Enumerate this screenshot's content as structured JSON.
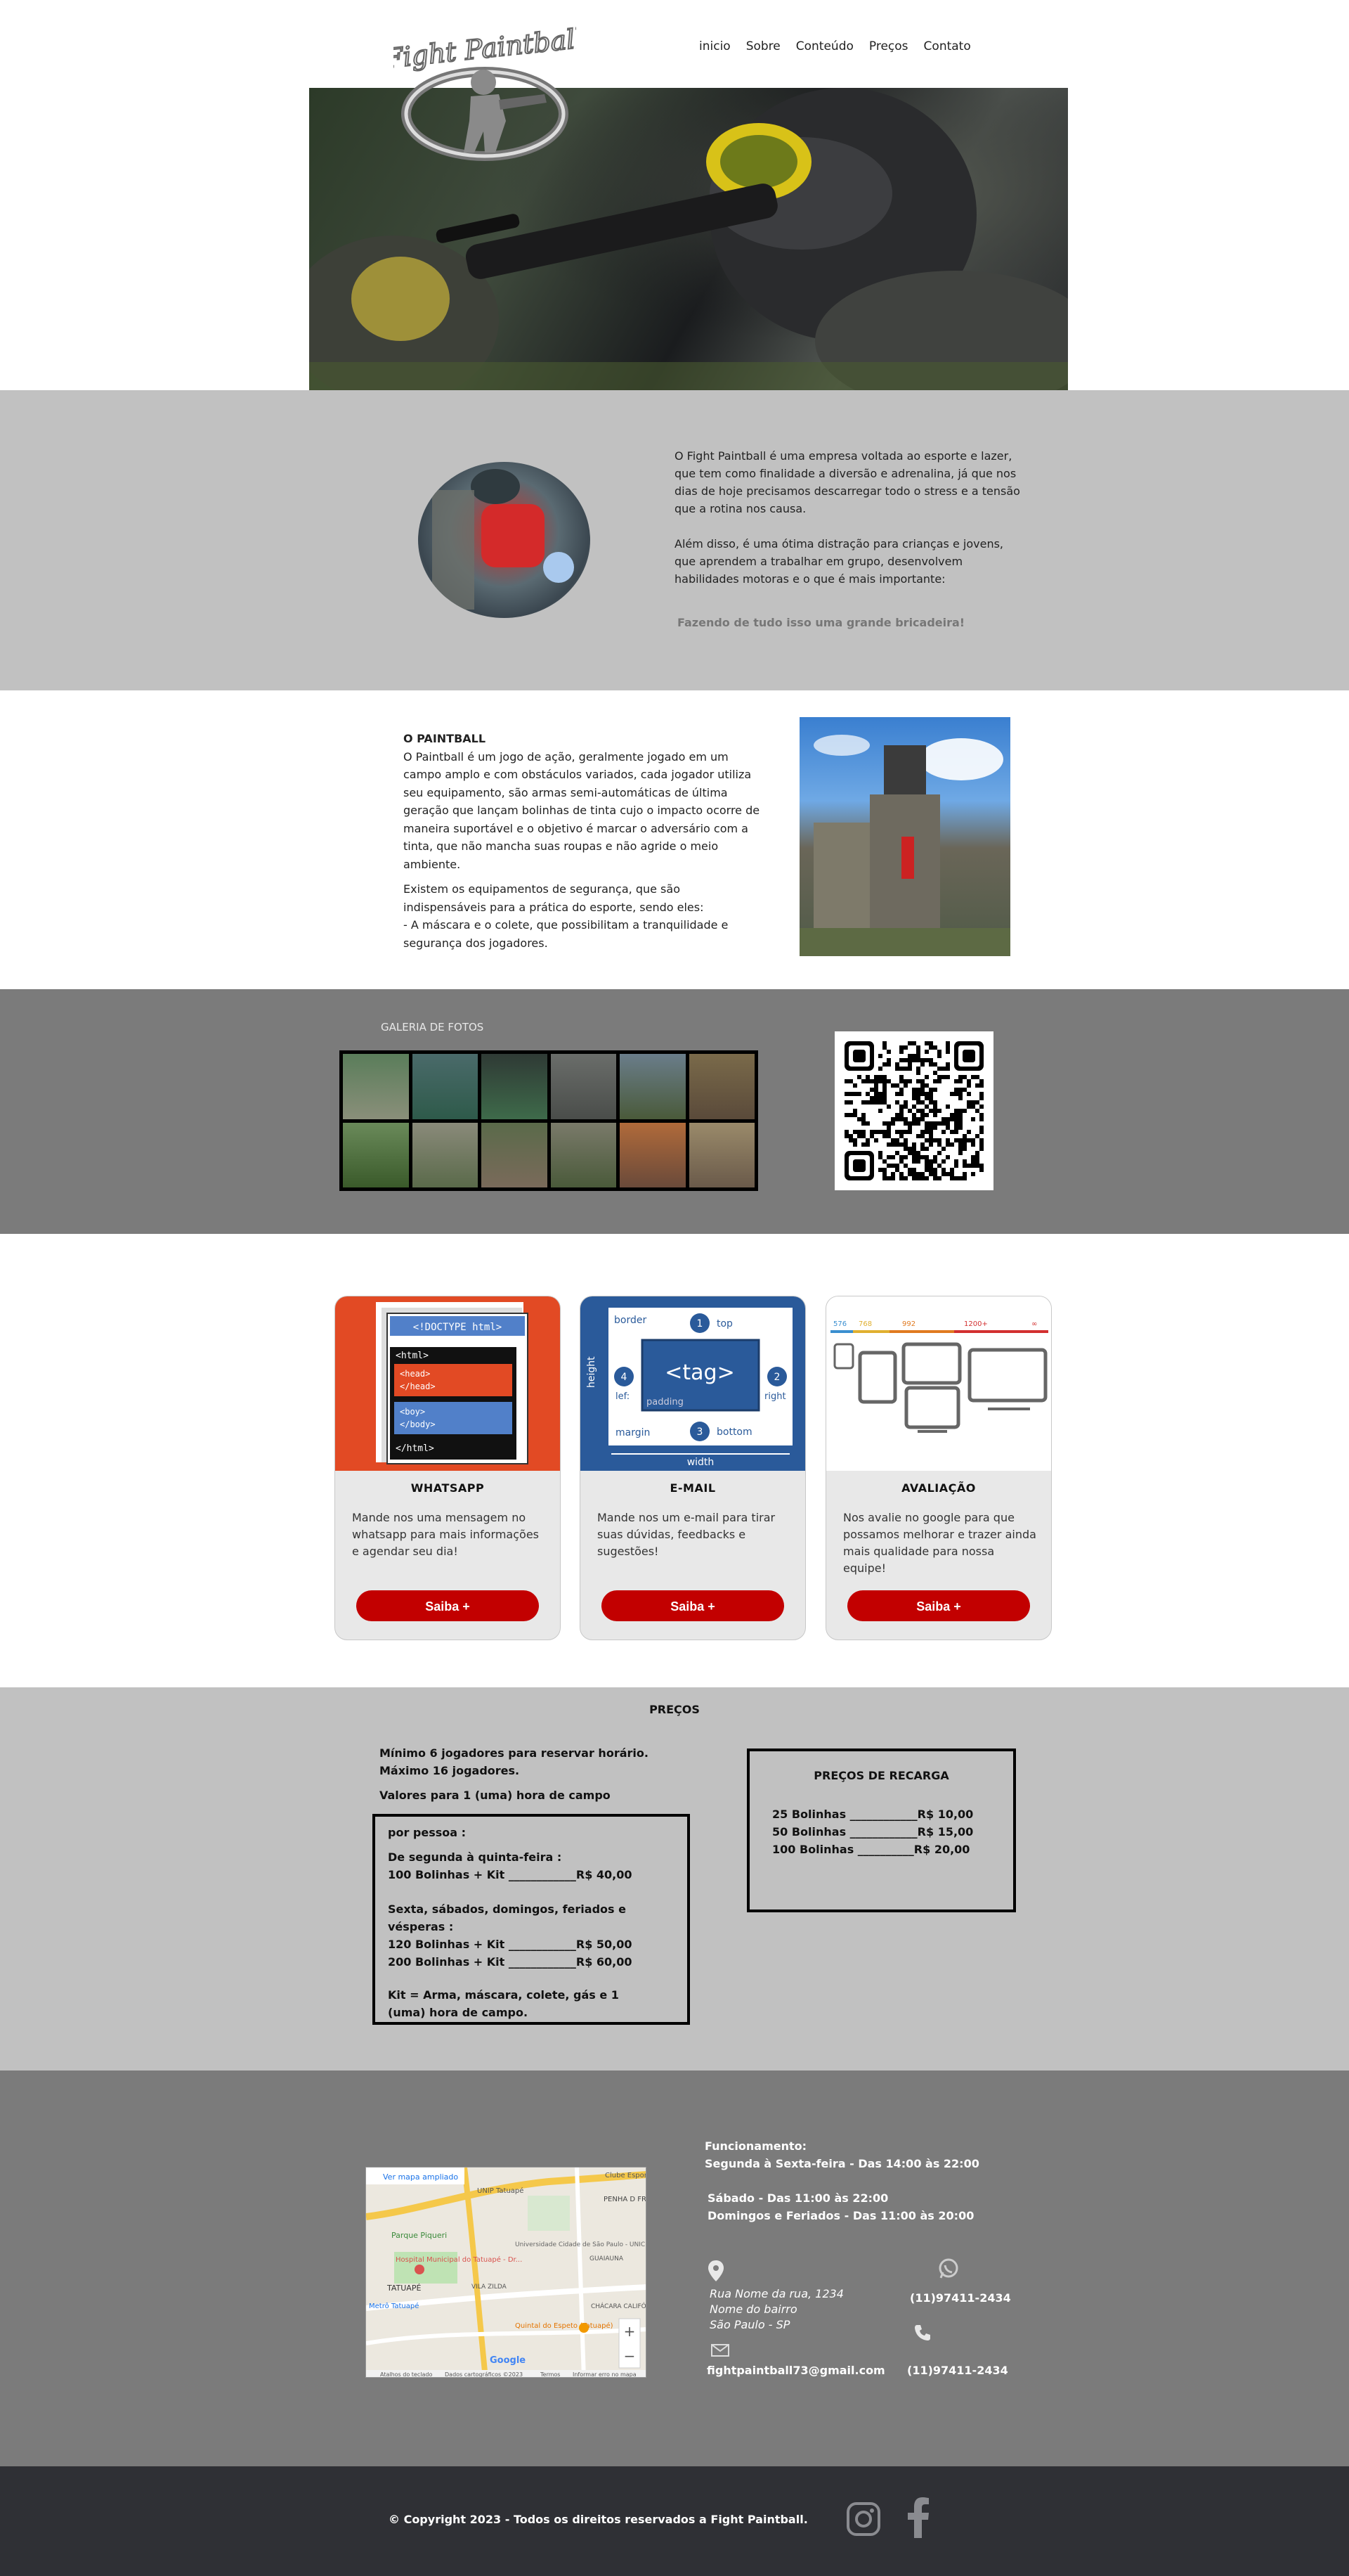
{
  "header": {
    "logo_text": "Fight Paintball",
    "nav": [
      "inicio",
      "Sobre",
      "Conteúdo",
      "Preços",
      "Contato"
    ]
  },
  "intro": {
    "paragraph1": "O Fight Paintball é uma empresa voltada ao esporte e lazer, que tem como finalidade a diversão e adrenalina, já que nos dias de hoje precisamos descarregar todo o stress e a tensão que a rotina nos causa.",
    "paragraph2": "Além disso, é uma ótima distração para crianças e jovens, que aprendem a trabalhar em grupo, desenvolvem habilidades motoras e o que é mais importante:",
    "tagline": "Fazendo de tudo isso uma grande bricadeira!"
  },
  "about": {
    "title": "O PAINTBALL",
    "paragraph1": "O Paintball é um jogo de ação, geralmente jogado em um campo amplo e com obstáculos variados, cada jogador utiliza seu equipamento, são armas semi-automáticas de última geração que lançam bolinhas de tinta cujo o impacto ocorre de maneira suportável e o objetivo é marcar o adversário com a tinta, que não mancha suas roupas e não agride o meio ambiente.",
    "paragraph2": "Existem os equipamentos de segurança, que são indispensáveis para a prática do esporte, sendo eles:",
    "paragraph3": "- A máscara e o colete, que possibilitam a tranquilidade e segurança dos jogadores."
  },
  "gallery": {
    "title": "GALERIA DE FOTOS"
  },
  "cards": [
    {
      "title": "WHATSAPP",
      "description": "Mande nos uma mensagem no whatsapp para mais informações e agendar seu dia!",
      "button": "Saiba +",
      "code": [
        "<!DOCTYPE html>",
        "<html>",
        "<head>",
        "</head>",
        "<boy>",
        "</body>",
        "</html>"
      ]
    },
    {
      "title": "E-MAIL",
      "description": "Mande nos um e-mail para tirar suas dúvidas, feedbacks e sugestões!",
      "button": "Saiba +",
      "labels": [
        "border",
        "top",
        "height",
        "<tag>",
        "lef:",
        "right",
        "padding",
        "margin",
        "bottom",
        "width",
        "1",
        "2",
        "3",
        "4"
      ]
    },
    {
      "title": "AVALIAÇÃO",
      "description": "Nos avalie no google para que possamos melhorar e trazer ainda mais qualidade para nossa equipe!",
      "button": "Saiba +",
      "breakpoints": [
        "576",
        "768",
        "992",
        "1200+",
        "∞"
      ]
    }
  ],
  "prices": {
    "title": "PREÇOS",
    "intro_lines": [
      "Mínimo 6 jogadores para reservar horário.",
      "Máximo 16 jogadores.",
      "Valores para 1 (uma) hora de campo"
    ],
    "box": {
      "per_person": "por pessoa :",
      "weekdays_label": "De segunda à quinta-feira :",
      "weekdays_line": "100 Bolinhas + Kit ____________R$ 40,00",
      "weekend_label": "Sexta, sábados, domingos, feriados e vésperas :",
      "weekend_line1": "120 Bolinhas + Kit ____________R$ 50,00",
      "weekend_line2": "200 Bolinhas + Kit ____________R$ 60,00",
      "kit_note": "Kit = Arma, máscara, colete, gás e 1 (uma) hora de campo."
    },
    "recharge": {
      "title": "PREÇOS DE RECARGA",
      "lines": [
        "25 Bolinhas ____________R$ 10,00",
        "50 Bolinhas ____________R$ 15,00",
        "100 Bolinhas __________R$ 20,00"
      ]
    }
  },
  "contact": {
    "hours_title": "Funcionamento:",
    "hours_week": "Segunda à Sexta-feira - Das 14:00 às 22:00",
    "hours_sat": "Sábado - Das 11:00 às 22:00",
    "hours_sun": "Domingos e Feriados - Das 11:00 às 20:00",
    "address_line1": "Rua Nome da rua, 1234",
    "address_line2": "Nome do bairro",
    "address_line3": "São Paulo - SP",
    "email": "fightpaintball73@gmail.com",
    "whatsapp": "(11)97411-2434",
    "phone": "(11)97411-2434",
    "map": {
      "link": "Ver mapa ampliado",
      "labels": [
        "UNIP Tatuapé",
        "PENHA D FRANÇA",
        "Clube Esport",
        "Parque Piqueri",
        "Universidade Cidade de São Paulo - UNICID",
        "GUAIAUNA",
        "Hospital Municipal do Tatuapé - Dr...",
        "TATUAPÉ",
        "VILA ZILDA",
        "CHÁCARA CALIFÓ",
        "Metrô Tatuapé",
        "Quintal do Espeto (Tatuapé)",
        "Google"
      ],
      "footer": [
        "Atalhos do teclado",
        "Dados cartográficos ©2023",
        "Termos",
        "Informar erro no mapa"
      ]
    }
  },
  "footer": {
    "copyright": "© Copyright 2023 - Todos os direitos reservados a Fight Paintball."
  },
  "colors": {
    "gray_light": "#c1c1c1",
    "gray_dark": "#7b7b7b",
    "footer": "#2f3035",
    "button_red": "#c20000"
  }
}
